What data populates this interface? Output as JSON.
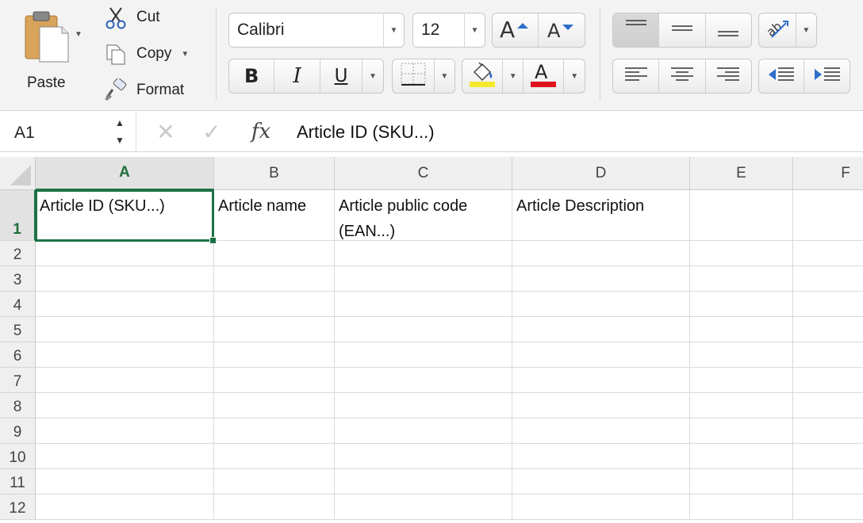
{
  "clipboard": {
    "paste_label": "Paste",
    "cut_label": "Cut",
    "copy_label": "Copy",
    "format_label": "Format"
  },
  "font": {
    "family": "Calibri",
    "size": "12"
  },
  "formula_bar": {
    "cell_ref": "A1",
    "content": "Article ID (SKU...)"
  },
  "grid": {
    "columns": [
      "A",
      "B",
      "C",
      "D",
      "E",
      "F"
    ],
    "rows": [
      "1",
      "2",
      "3",
      "4",
      "5",
      "6",
      "7",
      "8",
      "9",
      "10",
      "11",
      "12"
    ],
    "cells": {
      "A1": "Article ID (SKU...)",
      "B1": "Article name",
      "C1": "Article public code\n(EAN...)",
      "D1": "Article Description"
    },
    "active_cell": "A1"
  },
  "colors": {
    "accent": "#1e7145",
    "highlight": "#f5e92b",
    "font_color": "#e0141e"
  }
}
